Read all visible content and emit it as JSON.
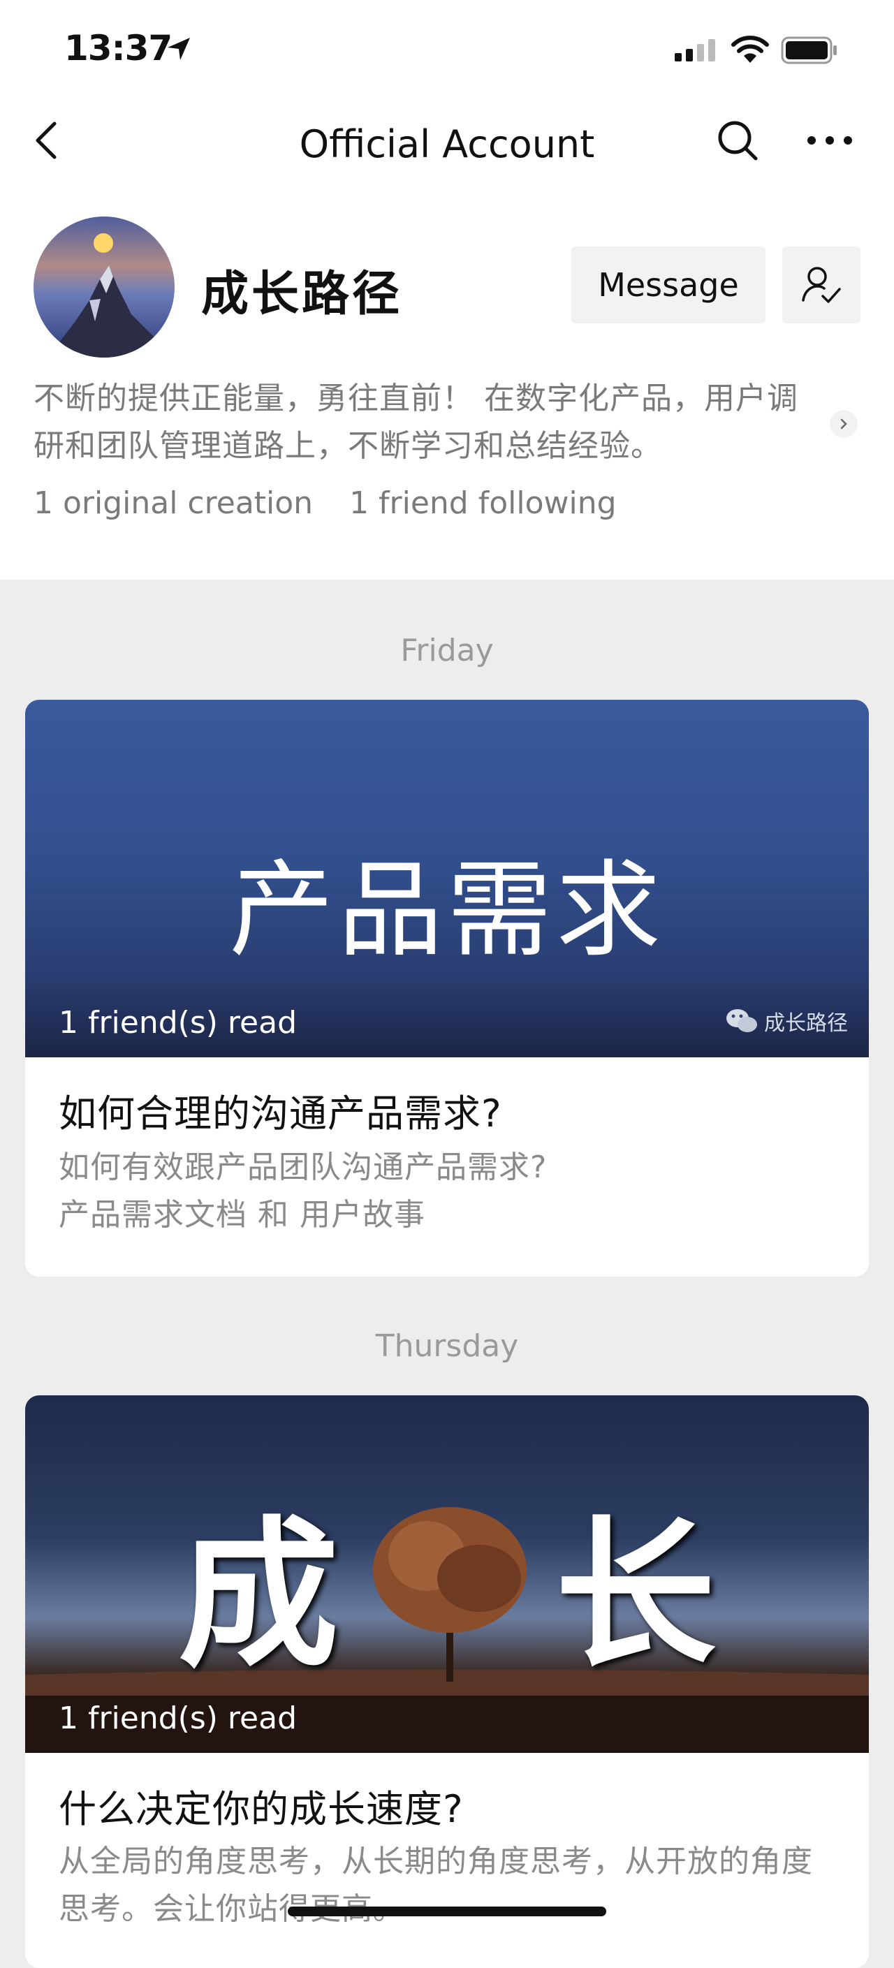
{
  "status_bar": {
    "time": "13:37"
  },
  "nav": {
    "title": "Official Account"
  },
  "profile": {
    "name": "成长路径",
    "message_label": "Message",
    "bio": "不断的提供正能量，勇往直前！ 在数字化产品，用户调研和团队管理道路上，不断学习和总结经验。",
    "stats": {
      "original": "1 original creation",
      "friends": "1 friend following"
    }
  },
  "feed": [
    {
      "date": "Friday",
      "cover_text": "产品需求",
      "read_count": "1 friend(s) read",
      "watermark": "成长路径",
      "title": "如何合理的沟通产品需求?",
      "desc_line1": "如何有效跟产品团队沟通产品需求?",
      "desc_line2": "产品需求文档 和 用户故事"
    },
    {
      "date": "Thursday",
      "cover_text_left": "成",
      "cover_text_right": "长",
      "read_count": "1 friend(s) read",
      "title": "什么决定你的成长速度?",
      "desc": "从全局的角度思考，从长期的角度思考，从开放的角度思考。会让你站得更高。"
    }
  ],
  "colors": {
    "accent_blue": "#2e4f8f",
    "bg": "#ededed",
    "muted": "#7a7a7a"
  },
  "icons": [
    "location-arrow-icon",
    "signal-icon",
    "wifi-icon",
    "battery-icon",
    "back-icon",
    "search-icon",
    "more-icon",
    "user-check-icon",
    "chevron-right-icon",
    "wechat-icon"
  ]
}
